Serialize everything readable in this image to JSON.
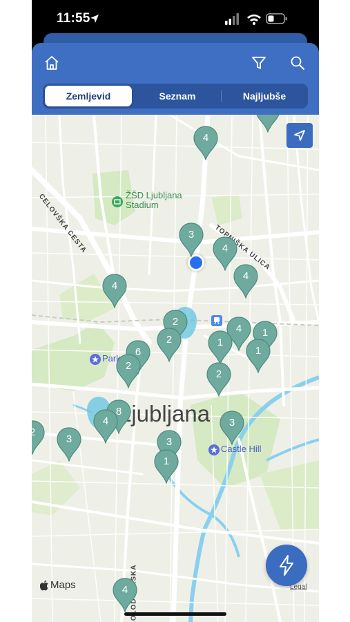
{
  "status_bar": {
    "time": "11:55",
    "icons": [
      "location-arrow-icon",
      "cellular-signal-icon",
      "wifi-icon",
      "battery-icon"
    ]
  },
  "app_bar": {
    "icons": {
      "home": "home-icon",
      "filter": "filter-icon",
      "search": "search-icon"
    },
    "tabs": [
      {
        "label": "Zemljevid",
        "active": true
      },
      {
        "label": "Seznam",
        "active": false
      },
      {
        "label": "Najljubše",
        "active": false
      }
    ]
  },
  "map": {
    "city_label": "Ljubljana",
    "street_labels": {
      "celovska": "CELOVŠKA CESTA",
      "topniska": "TOPNIŠKA ULICA",
      "kolodvor": "KOLODVORSKA"
    },
    "poi_labels": {
      "stadium": "ŽŠD Ljubljana Stadium",
      "park": "Park Tivoli",
      "castle": "Castle Hill"
    },
    "maps_attribution": "Maps",
    "legal_label": "Legal",
    "pins": [
      {
        "count": "4"
      },
      {
        "count": "3"
      },
      {
        "count": "4"
      },
      {
        "count": "4"
      },
      {
        "count": "4"
      },
      {
        "count": "2"
      },
      {
        "count": "2"
      },
      {
        "count": "4"
      },
      {
        "count": "1"
      },
      {
        "count": "1"
      },
      {
        "count": "6"
      },
      {
        "count": "1"
      },
      {
        "count": "2"
      },
      {
        "count": "2"
      },
      {
        "count": "8"
      },
      {
        "count": "4"
      },
      {
        "count": "3"
      },
      {
        "count": "2"
      },
      {
        "count": "3"
      },
      {
        "count": "3"
      },
      {
        "count": "1"
      },
      {
        "count": "4"
      }
    ],
    "colors": {
      "pin": "#6eaa9d",
      "pin_highlight": "#6cc7e0",
      "user_location": "#2a6ef0",
      "accent": "#3f6fc2"
    }
  },
  "buttons": {
    "locate": "location-arrow-icon",
    "fab": "lightning-icon"
  }
}
